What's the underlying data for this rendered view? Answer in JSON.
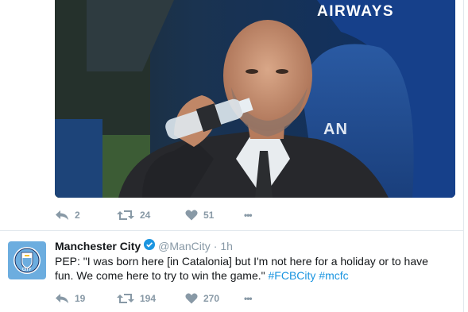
{
  "photo": {
    "banner_text": "AIRWAYS",
    "seat_text": "AN"
  },
  "tweet1_actions": {
    "reply_count": "2",
    "retweet_count": "24",
    "like_count": "51",
    "more_label": "•••"
  },
  "tweet2": {
    "display_name": "Manchester City",
    "handle": "@ManCity",
    "separator": "·",
    "time": "1h",
    "text": "PEP: \"I was born here [in Catalonia] but I'm not here for a holiday or to have fun. We come here to try to win the game.\" ",
    "hashtag1": "#FCBCity",
    "hashtag2": "#mcfc",
    "badge_text": "CITY",
    "reply_count": "19",
    "retweet_count": "194",
    "like_count": "270",
    "more_label": "•••"
  },
  "colors": {
    "accent": "#1b95e0",
    "muted": "#8899a6",
    "avatar_bg": "#6caddf",
    "border": "#e1e8ed"
  }
}
